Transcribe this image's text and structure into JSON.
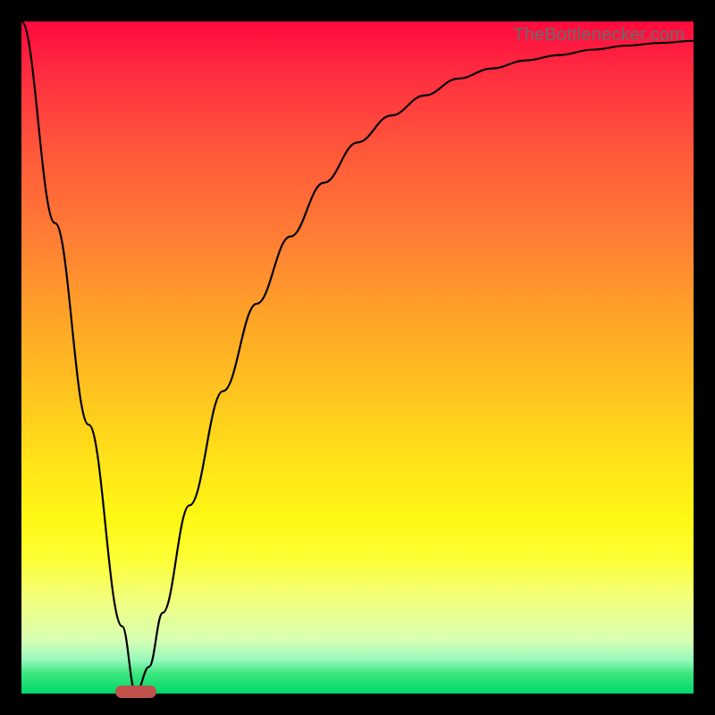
{
  "watermark": "TheBottlenecker.com",
  "colors": {
    "frame": "#000000",
    "gradient_top": "#ff0a3e",
    "gradient_mid": "#ffe418",
    "gradient_bottom": "#00d86a",
    "curve": "#000000",
    "marker": "#c0524b"
  },
  "chart_data": {
    "type": "line",
    "title": "",
    "xlabel": "",
    "ylabel": "",
    "xlim": [
      0,
      100
    ],
    "ylim": [
      0,
      100
    ],
    "series": [
      {
        "name": "bottleneck-curve",
        "x": [
          0,
          5,
          10,
          15,
          17,
          19,
          21,
          25,
          30,
          35,
          40,
          45,
          50,
          55,
          60,
          65,
          70,
          75,
          80,
          85,
          90,
          95,
          100
        ],
        "values": [
          100,
          70,
          40,
          10,
          0,
          4,
          12,
          28,
          45,
          58,
          68,
          76,
          82,
          86,
          89,
          91.5,
          93,
          94.2,
          95,
          95.8,
          96.4,
          96.8,
          97.1
        ]
      }
    ],
    "marker": {
      "x": 17,
      "y": 0,
      "shape": "pill"
    },
    "annotations": []
  }
}
